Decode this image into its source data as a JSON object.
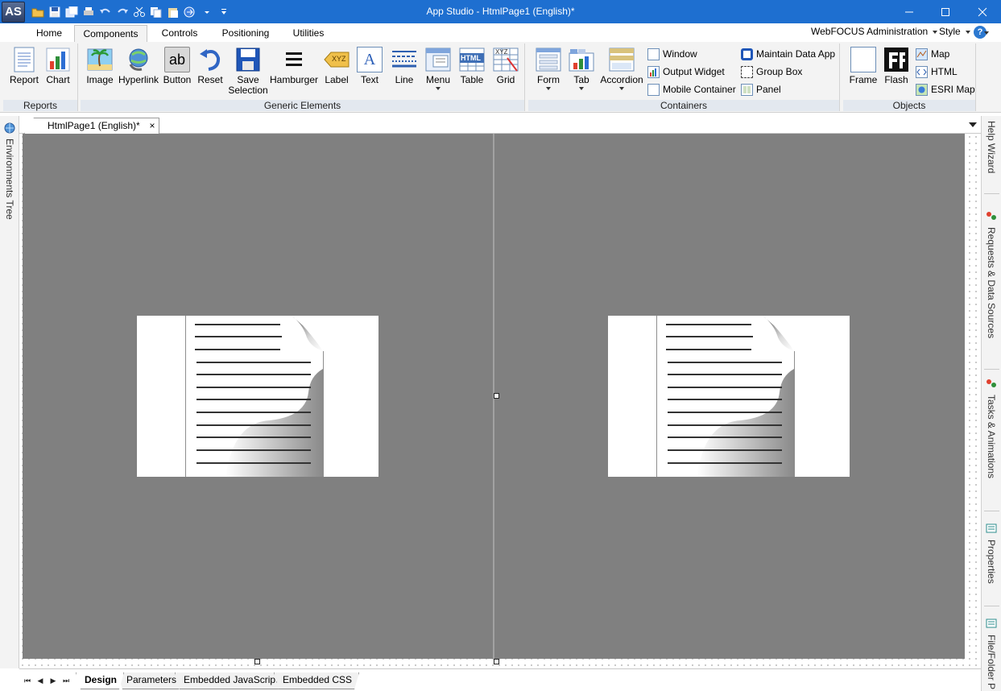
{
  "app": {
    "logo_text": "AS",
    "title": "App Studio - HtmlPage1 (English)*"
  },
  "ribbon_tabs": [
    "Home",
    "Components",
    "Controls",
    "Positioning",
    "Utilities"
  ],
  "ribbon_active_tab": "Components",
  "header_right": {
    "admin": "WebFOCUS Administration",
    "style": "Style",
    "help": "?"
  },
  "groups": {
    "reports": {
      "label": "Reports",
      "buttons": [
        "Report",
        "Chart"
      ]
    },
    "generic": {
      "label": "Generic Elements",
      "buttons": [
        "Image",
        "Hyperlink",
        "Button",
        "Reset",
        "Save Selection",
        "Hamburger",
        "Label",
        "Text",
        "Line",
        "Menu",
        "Table",
        "Grid"
      ],
      "label_icon_text": "XYZ",
      "button_icon_text": "ab",
      "text_icon_text": "A",
      "table_icon_text": "HTML",
      "grid_icon_text": "XYZ"
    },
    "containers": {
      "label": "Containers",
      "buttons": [
        "Form",
        "Tab",
        "Accordion"
      ],
      "small_col1": [
        "Window",
        "Output Widget",
        "Mobile Container"
      ],
      "small_col2": [
        "Maintain Data App",
        "Group Box",
        "Panel"
      ]
    },
    "objects": {
      "label": "Objects",
      "buttons": [
        "Frame",
        "Flash"
      ],
      "small": [
        "Map",
        "HTML",
        "ESRI Map"
      ]
    }
  },
  "document_tab": {
    "label": "HtmlPage1 (English)*",
    "close": "×"
  },
  "left_panel": [
    "Environments Tree"
  ],
  "right_panel": [
    "Help Wizard",
    "Requests & Data Sources",
    "Tasks & Animations",
    "Properties",
    "File/Folder P"
  ],
  "bottom_tabs": [
    "Design",
    "Parameters",
    "Embedded JavaScript",
    "Embedded CSS"
  ],
  "bottom_active_tab": "Design",
  "nav_arrows": [
    "⏮",
    "◀",
    "▶",
    "⏭"
  ],
  "colors": {
    "titlebar": "#1e6fd0",
    "design_area": "#808080",
    "ribbon_bg": "#f3f3f3"
  }
}
